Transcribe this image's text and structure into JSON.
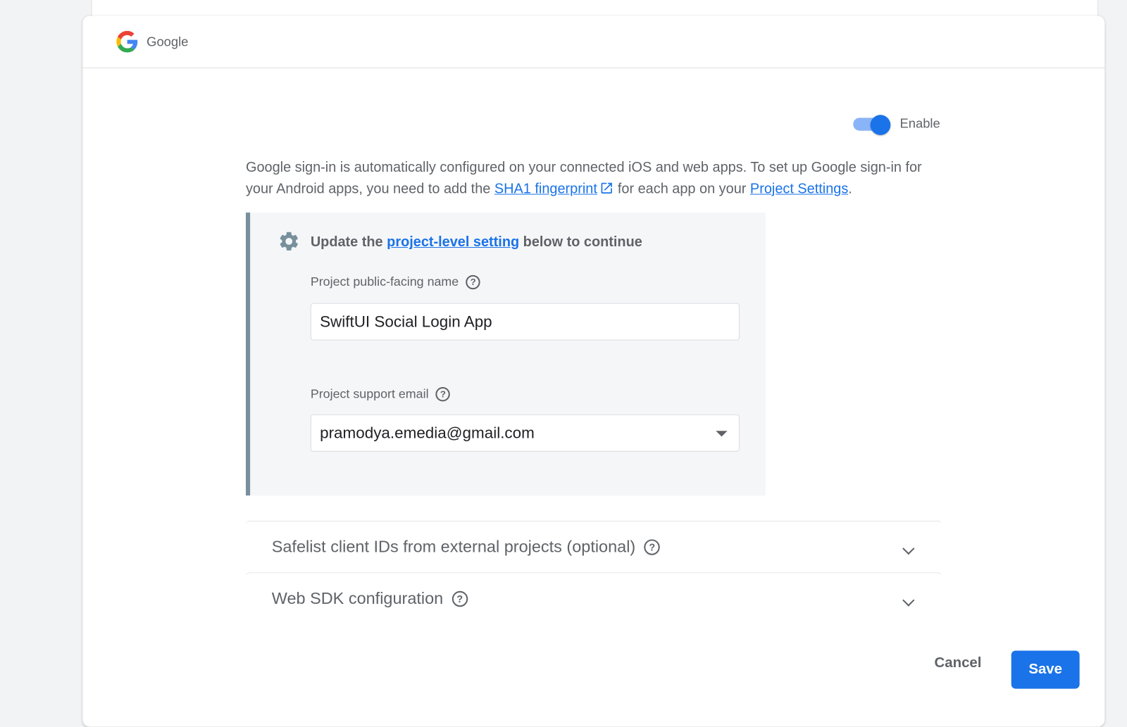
{
  "provider": {
    "name": "Google",
    "icon": "google-g-logo"
  },
  "toggle": {
    "label": "Enable",
    "enabled": true,
    "accent": "#1a73e8"
  },
  "description": {
    "part1": "Google sign-in is automatically configured on your connected iOS and web apps. To set up Google sign-in for your Android apps, you need to add the ",
    "link1": "SHA1 fingerprint",
    "part2": " for each app on your ",
    "link2": "Project Settings",
    "part3": "."
  },
  "panel": {
    "title_pre": "Update the ",
    "title_link": "project-level setting",
    "title_post": " below to continue",
    "name_label": "Project public-facing name",
    "name_value": "SwiftUI Social Login App",
    "email_label": "Project support email",
    "email_value": "pramodya.emedia@gmail.com"
  },
  "accordions": [
    {
      "label": "Safelist client IDs from external projects (optional)"
    },
    {
      "label": "Web SDK configuration"
    }
  ],
  "help_glyph": "?",
  "actions": {
    "cancel": "Cancel",
    "save": "Save"
  }
}
